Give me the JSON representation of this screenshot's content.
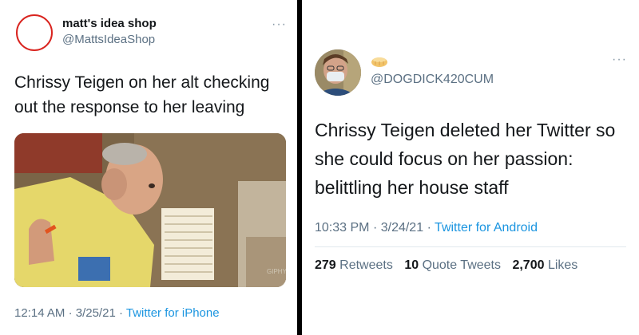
{
  "left_tweet": {
    "display_name": "matt's idea shop",
    "handle": "@MattsIdeaShop",
    "more_icon": "ellipsis-icon",
    "text": "Chrissy Teigen on her alt checking out the response to her leaving",
    "media_watermark": "GIPHY",
    "time": "12:14 AM",
    "date": "3/25/21",
    "source": "Twitter for iPhone",
    "separator": "·",
    "avatar_ring_color": "#d9241f"
  },
  "right_tweet": {
    "handle": "@DOGDICK420CUM",
    "more_icon": "ellipsis-icon",
    "name_icon": "bread-emoji",
    "text": "Chrissy Teigen deleted her Twitter so she could focus on her passion: belittling her house staff",
    "time": "10:33 PM",
    "date": "3/24/21",
    "source": "Twitter for Android",
    "separator": "·",
    "retweets_count": "279",
    "retweets_label": "Retweets",
    "quotes_count": "10",
    "quotes_label": "Quote Tweets",
    "likes_count": "2,700",
    "likes_label": "Likes"
  },
  "colors": {
    "link_blue": "#1b95e0",
    "text_dark": "#14171a",
    "text_gray": "#5b7083",
    "divider_black": "#000000"
  }
}
